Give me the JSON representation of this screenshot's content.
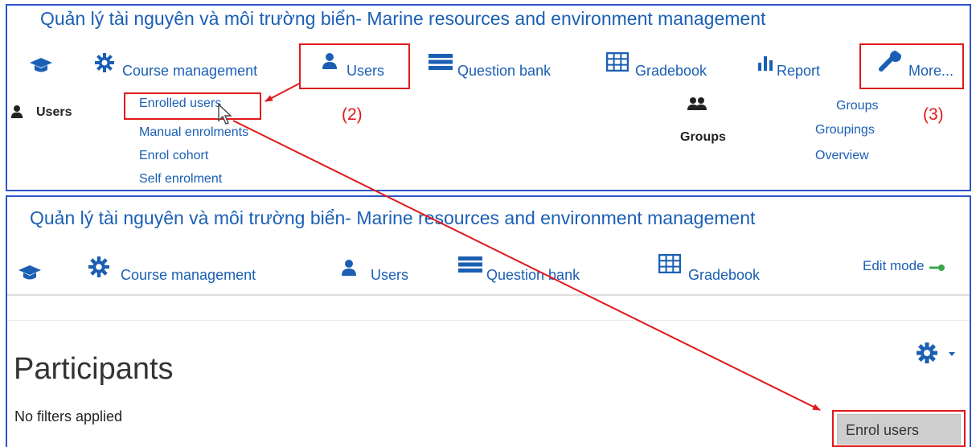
{
  "top": {
    "title": "Quản lý tài nguyên và môi trường biển- Marine resources and environment management",
    "nav": {
      "course_management": "Course management",
      "users": "Users",
      "question_bank": "Question bank",
      "gradebook": "Gradebook",
      "report": "Report",
      "more": "More..."
    },
    "users_section": {
      "heading": "Users",
      "links": [
        "Enrolled users",
        "Manual enrolments",
        "Enrol cohort",
        "Self enrolment"
      ]
    },
    "groups_section": {
      "heading": "Groups",
      "links": [
        "Groups",
        "Groupings",
        "Overview"
      ]
    }
  },
  "bottom": {
    "title": "Quản lý tài nguyên và môi trường biển- Marine resources and environment management",
    "nav": {
      "course_management": "Course management",
      "users": "Users",
      "question_bank": "Question bank",
      "gradebook": "Gradebook",
      "edit_mode": "Edit mode"
    },
    "page_heading": "Participants",
    "filters_text": "No filters applied",
    "enrol_button": "Enrol users"
  },
  "annotations": {
    "step2": "(2)",
    "step3": "(3)"
  },
  "colors": {
    "link": "#1a5fb4",
    "panel_border": "#2e54c8",
    "highlight": "#e0191b"
  }
}
